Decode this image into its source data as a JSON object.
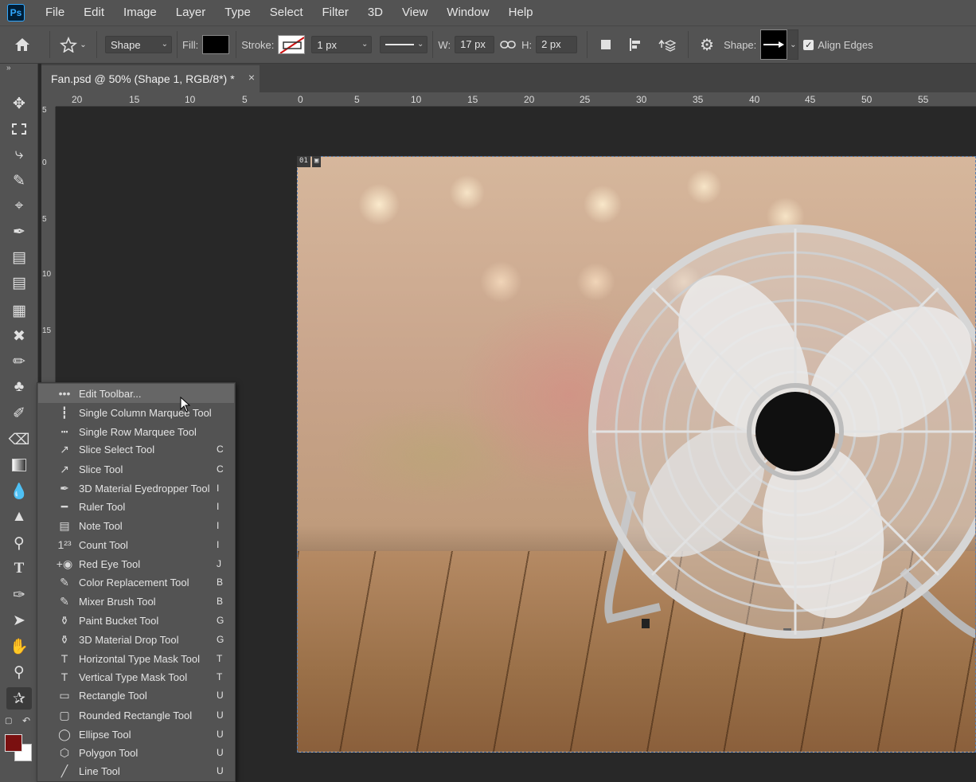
{
  "menubar": {
    "logo": "Ps",
    "items": [
      "File",
      "Edit",
      "Image",
      "Layer",
      "Type",
      "Select",
      "Filter",
      "3D",
      "View",
      "Window",
      "Help"
    ]
  },
  "options": {
    "mode": "Shape",
    "fill_label": "Fill:",
    "stroke_label": "Stroke:",
    "stroke_width": "1 px",
    "w_label": "W:",
    "w_value": "17 px",
    "h_label": "H:",
    "h_value": "2 px",
    "shape_label": "Shape:",
    "align_edges_label": "Align Edges",
    "align_edges_checked": true,
    "fill_color": "#000000"
  },
  "document": {
    "tab_title": "Fan.psd @ 50% (Shape 1, RGB/8*)",
    "modified_marker": "*",
    "close_glyph": "×",
    "artboard_number": "01"
  },
  "rulers": {
    "horizontal": [
      "20",
      "15",
      "10",
      "5",
      "0",
      "5",
      "10",
      "15",
      "20",
      "25",
      "30",
      "35",
      "40",
      "45",
      "50",
      "55"
    ],
    "vertical": [
      "5",
      "0",
      "5",
      "10",
      "15"
    ]
  },
  "colors": {
    "foreground": "#7a1010",
    "background": "#ffffff",
    "accent": "#31a8ff"
  },
  "flyout": {
    "items": [
      {
        "icon": "ellipsis-icon",
        "label": "Edit Toolbar...",
        "key": ""
      },
      {
        "icon": "single-column-marquee-icon",
        "label": "Single Column Marquee Tool",
        "key": ""
      },
      {
        "icon": "single-row-marquee-icon",
        "label": "Single Row Marquee Tool",
        "key": ""
      },
      {
        "icon": "slice-select-icon",
        "label": "Slice Select Tool",
        "key": "C"
      },
      {
        "icon": "slice-icon",
        "label": "Slice Tool",
        "key": "C"
      },
      {
        "icon": "3d-eyedropper-icon",
        "label": "3D Material Eyedropper Tool",
        "key": "I"
      },
      {
        "icon": "ruler-icon",
        "label": "Ruler Tool",
        "key": "I"
      },
      {
        "icon": "note-icon",
        "label": "Note Tool",
        "key": "I"
      },
      {
        "icon": "count-icon",
        "label": "Count Tool",
        "key": "I"
      },
      {
        "icon": "red-eye-icon",
        "label": "Red Eye Tool",
        "key": "J"
      },
      {
        "icon": "color-replacement-icon",
        "label": "Color Replacement Tool",
        "key": "B"
      },
      {
        "icon": "mixer-brush-icon",
        "label": "Mixer Brush Tool",
        "key": "B"
      },
      {
        "icon": "paint-bucket-icon",
        "label": "Paint Bucket Tool",
        "key": "G"
      },
      {
        "icon": "3d-drop-icon",
        "label": "3D Material Drop Tool",
        "key": "G"
      },
      {
        "icon": "horizontal-type-mask-icon",
        "label": "Horizontal Type Mask Tool",
        "key": "T"
      },
      {
        "icon": "vertical-type-mask-icon",
        "label": "Vertical Type Mask Tool",
        "key": "T"
      },
      {
        "icon": "rectangle-icon",
        "label": "Rectangle Tool",
        "key": "U"
      },
      {
        "icon": "rounded-rectangle-icon",
        "label": "Rounded Rectangle Tool",
        "key": "U"
      },
      {
        "icon": "ellipse-icon",
        "label": "Ellipse Tool",
        "key": "U"
      },
      {
        "icon": "polygon-icon",
        "label": "Polygon Tool",
        "key": "U"
      },
      {
        "icon": "line-icon",
        "label": "Line Tool",
        "key": "U"
      }
    ],
    "icon_glyphs": [
      "•••",
      "┇",
      "┅",
      "↗",
      "↗",
      "✒",
      "━",
      "▤",
      "1²³",
      "+◉",
      "✎",
      "✎",
      "⚱",
      "⚱",
      "T",
      "T",
      "▭",
      "▢",
      "◯",
      "⬡",
      "╱"
    ]
  }
}
